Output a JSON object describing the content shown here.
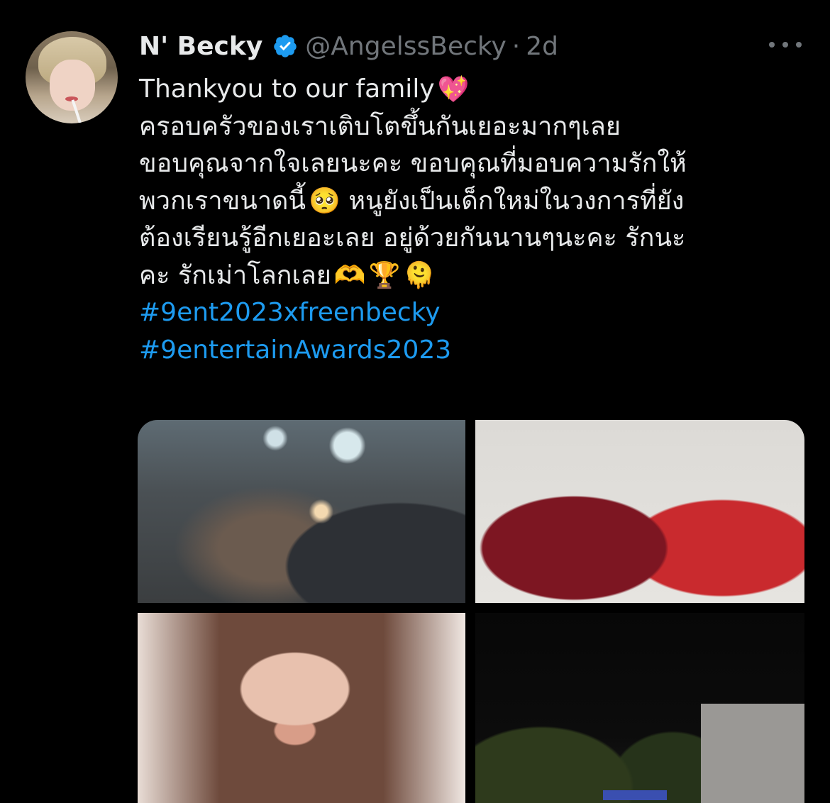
{
  "tweet": {
    "author_name": "N' Becky",
    "handle": "@AngelssBecky",
    "separator": "·",
    "time": "2d",
    "lines": [
      "Thankyou to our family",
      "ครอบครัวของเราเติบโตขึ้นกันเยอะมากๆเลย",
      "ขอบคุณจากใจเลยนะคะ ขอบคุณที่มอบความรักให้",
      "พวกเราขนาดนี้",
      "หนูยังเป็นเด็กใหม่ในวงการที่ยัง",
      "ต้องเรียนรู้อีกเยอะเลย อยู่ด้วยกันนานๆนะคะ รักนะ",
      "คะ รักเม่าโลกเลย"
    ],
    "emojis": {
      "sparkling_heart": "💖",
      "pleading": "🥺",
      "heart_hands": "🫶",
      "trophy": "🏆",
      "melting": "🫠"
    },
    "hashtags": [
      "#9ent2023xfreenbecky",
      "#9entertainAwards2023"
    ]
  },
  "icons": {
    "verified": "verified-badge-icon",
    "more": "more-options-icon"
  },
  "colors": {
    "background": "#000000",
    "text": "#e7e9ea",
    "secondary_text": "#71767b",
    "link": "#1d9bf0",
    "verified": "#1d9bf0"
  }
}
